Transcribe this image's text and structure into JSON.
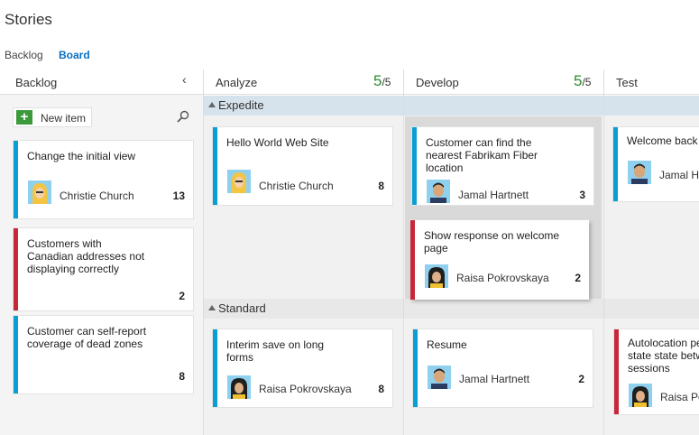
{
  "page": {
    "title": "Stories"
  },
  "tabs": [
    {
      "label": "Backlog"
    },
    {
      "label": "Board"
    }
  ],
  "columns": [
    {
      "name": "Backlog"
    },
    {
      "name": "Analyze",
      "wip_count": "5",
      "wip_limit": "/5"
    },
    {
      "name": "Develop",
      "wip_count": "5",
      "wip_limit": "/5"
    },
    {
      "name": "Test"
    }
  ],
  "new_item": {
    "label": "New item"
  },
  "lanes": [
    {
      "label": "Expedite"
    },
    {
      "label": "Standard"
    }
  ],
  "backlog_cards": [
    {
      "title": "Change the initial view",
      "assignee": "Christie Church",
      "points": "13"
    },
    {
      "title": "Customers with Canadian addresses not displaying correctly",
      "points": "2"
    },
    {
      "title": "Customer can self-report coverage of dead zones",
      "points": "8"
    }
  ],
  "board_cards": [
    {
      "title": "Hello World Web Site",
      "assignee": "Christie Church",
      "points": "8"
    },
    {
      "title": "Customer can find the nearest Fabrikam Fiber location",
      "assignee": "Jamal Hartnett",
      "points": "3"
    },
    {
      "title": "Show response on welcome page",
      "assignee": "Raisa Pokrovskaya",
      "points": "2"
    },
    {
      "title": "Welcome back p",
      "assignee": "Jamal Har"
    },
    {
      "title": "Interim save on long forms",
      "assignee": "Raisa Pokrovskaya",
      "points": "8"
    },
    {
      "title": "Resume",
      "assignee": "Jamal Hartnett",
      "points": "2"
    },
    {
      "title": "Autolocation pe state state betw sessions",
      "assignee": "Raisa Pok"
    }
  ],
  "colors": {
    "accent": "#0a6fc2",
    "card_blue": "#0a9fd4",
    "card_red": "#c8273a",
    "wip_green": "#2e8b2e"
  }
}
